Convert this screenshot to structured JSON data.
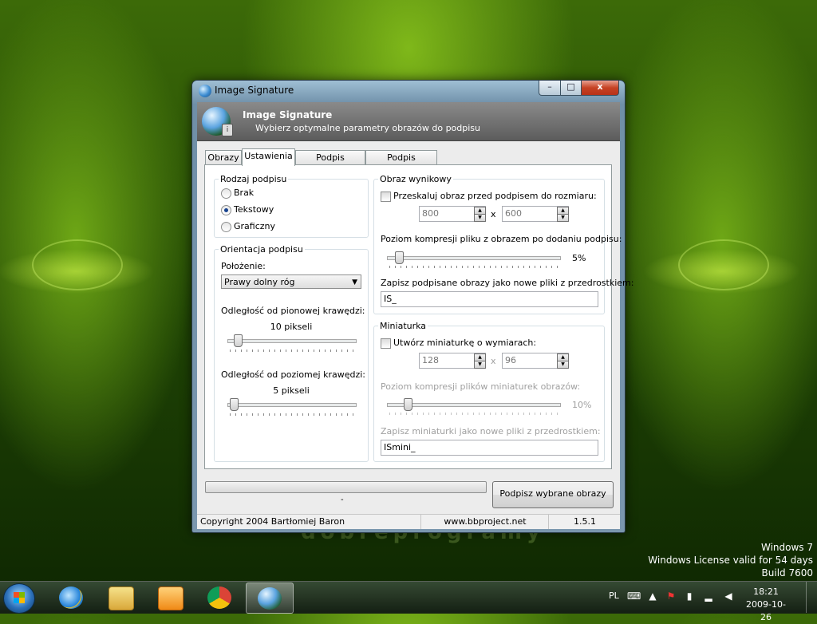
{
  "desktop": {
    "watermark": "dobreprogramy",
    "windows_info": [
      "Windows 7",
      "Windows License valid for 54 days",
      "Build 7600"
    ]
  },
  "window": {
    "title": "Image Signature",
    "caption_min": "–",
    "caption_max": "□",
    "caption_close": "x",
    "header_title": "Image Signature",
    "header_subtitle": "Wybierz optymalne parametry obrazów do podpisu",
    "tabs": [
      {
        "label": "Obrazy"
      },
      {
        "label": "Ustawienia"
      },
      {
        "label": "Podpis tekstowy"
      },
      {
        "label": "Podpis graficzny"
      }
    ],
    "active_tab": "Ustawienia",
    "rodzaj": {
      "label": "Rodzaj podpisu",
      "options": [
        "Brak",
        "Tekstowy",
        "Graficzny"
      ],
      "selected": "Tekstowy"
    },
    "orientacja": {
      "label": "Orientacja podpisu",
      "polozenie_label": "Położenie:",
      "polozenie_value": "Prawy dolny róg",
      "pion_label": "Odległość od pionowej krawędzi:",
      "pion_value": "10 pikseli",
      "pion_slider_fraction": 0.05,
      "poziom_label": "Odległość od poziomej krawędzi:",
      "poziom_value": "5 pikseli",
      "poziom_slider_fraction": 0.02
    },
    "obraz": {
      "label": "Obraz wynikowy",
      "rescale_label": "Przeskaluj obraz przed podpisem do rozmiaru:",
      "rescale_checked": false,
      "width": "800",
      "height": "600",
      "x_sep": "x",
      "compression_label": "Poziom kompresji pliku z obrazem po dodaniu podpisu:",
      "compression_value": "5%",
      "compression_fraction": 0.05,
      "prefix_label": "Zapisz podpisane obrazy jako nowe pliki z przedrostkiem:",
      "prefix_value": "IS_"
    },
    "miniatura": {
      "label": "Miniaturka",
      "create_label": "Utwórz miniaturkę o wymiarach:",
      "create_checked": false,
      "width": "128",
      "height": "96",
      "x_sep": "x",
      "compression_label": "Poziom kompresji plików miniaturek obrazów:",
      "compression_value": "10%",
      "compression_fraction": 0.1,
      "prefix_label": "Zapisz miniaturki jako nowe pliki z przedrostkiem:",
      "prefix_value": "ISmini_"
    },
    "progress_text": "-",
    "progress_fraction": 0,
    "sign_button": "Podpisz wybrane obrazy",
    "status": {
      "copyright": "Copyright 2004 Bartłomiej Baron",
      "website": "www.bbproject.net",
      "version": "1.5.1"
    }
  },
  "taskbar": {
    "language": "PL",
    "time": "18:21",
    "date": "2009-10-26",
    "pinned_icons": [
      "internet-explorer-icon",
      "windows-explorer-icon",
      "media-player-icon",
      "chrome-icon",
      "image-signature-icon"
    ]
  }
}
